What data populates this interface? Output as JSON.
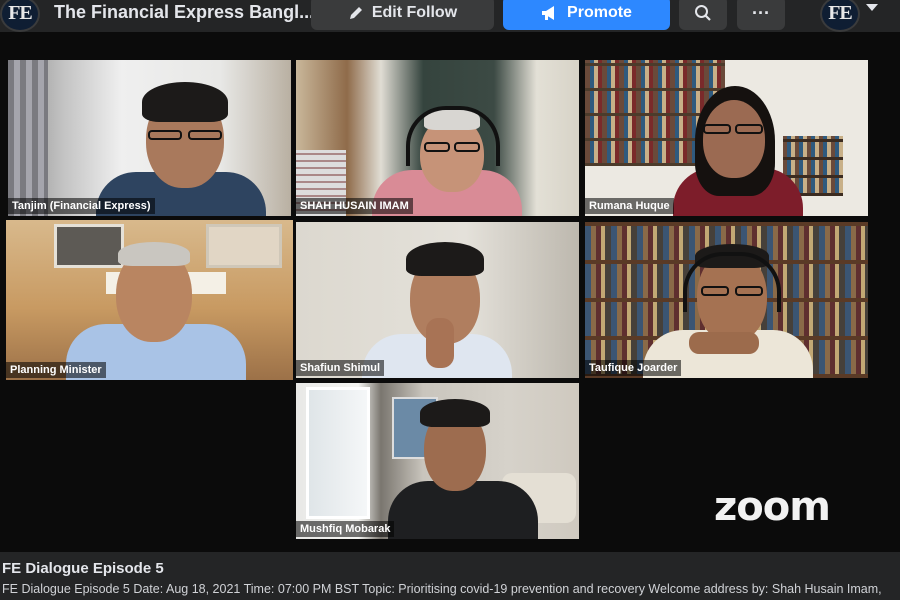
{
  "header": {
    "page_name": "The Financial Express Bangl...",
    "avatar_text": "FE",
    "edit_follow_label": "Edit Follow",
    "promote_label": "Promote",
    "more_label": "···"
  },
  "participants": [
    {
      "name": "Tanjim (Financial Express)"
    },
    {
      "name": "SHAH HUSAIN IMAM"
    },
    {
      "name": "Rumana Huque"
    },
    {
      "name": "Planning Minister"
    },
    {
      "name": "Shafiun Shimul"
    },
    {
      "name": "Taufique Joarder"
    },
    {
      "name": "Mushfiq Mobarak"
    }
  ],
  "zoom_logo": "zoom",
  "post": {
    "title": "FE Dialogue Episode 5",
    "text": "FE Dialogue Episode 5 Date: Aug 18, 2021 Time: 07:00 PM BST Topic: Prioritising covid-19 prevention and recovery Welcome address by: Shah Husain Imam,"
  },
  "colors": {
    "active_speaker_border": "#4ec94e",
    "promote_button": "#2d88ff",
    "topbar_bg": "#242526"
  }
}
